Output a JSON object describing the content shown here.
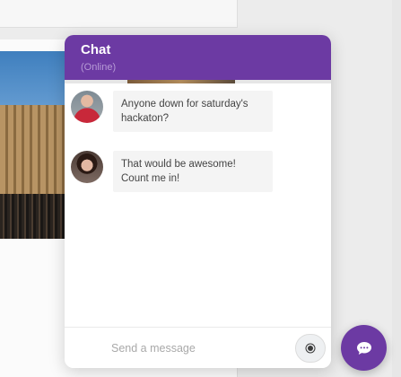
{
  "chat": {
    "title": "Chat",
    "status": "(Online)",
    "accent_color": "#6c3aa3",
    "messages": [
      {
        "avatar": "user-avatar-man",
        "text": "Anyone down for saturday's hackaton?"
      },
      {
        "avatar": "user-avatar-woman",
        "text": "That would be awesome! Count me in!"
      }
    ],
    "input_placeholder": "Send a message",
    "send_icon": "send-icon",
    "launcher_icon": "chat-bubble-icon"
  }
}
